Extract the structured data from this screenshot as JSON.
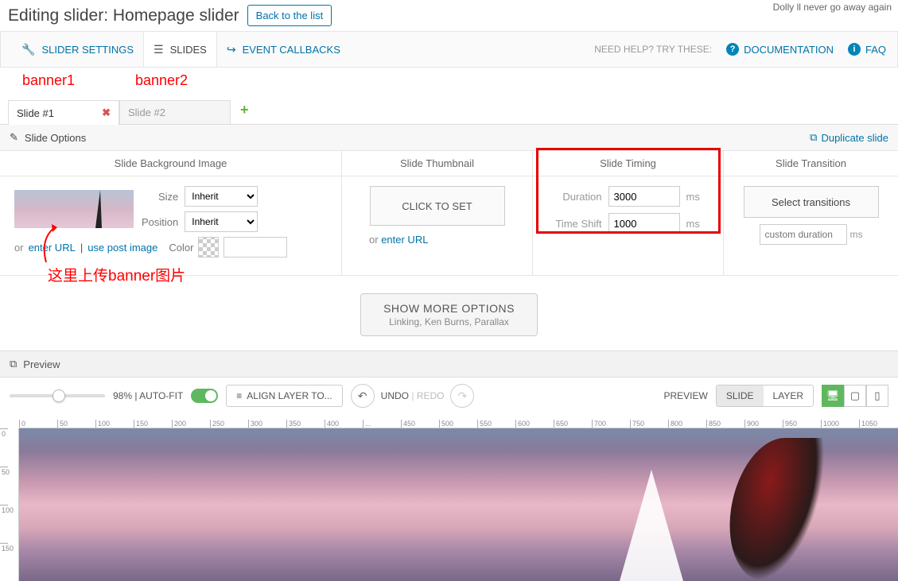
{
  "header": {
    "title": "Editing slider: Homepage slider",
    "back_btn": "Back to the list",
    "dolly": "Dolly ll never go away again"
  },
  "mainTabs": {
    "settings": "SLIDER SETTINGS",
    "slides": "SLIDES",
    "callbacks": "EVENT CALLBACKS"
  },
  "help": {
    "label": "NEED HELP? TRY THESE:",
    "documentation": "DOCUMENTATION",
    "faq": "FAQ"
  },
  "annotations": {
    "banner1": "banner1",
    "banner2": "banner2",
    "upload": "这里上传banner图片"
  },
  "slideTabs": {
    "tab1": "Slide #1",
    "tab2": "Slide #2"
  },
  "optionsBar": {
    "title": "Slide Options",
    "duplicate": "Duplicate slide"
  },
  "columns": {
    "bg": {
      "header": "Slide Background Image",
      "size_label": "Size",
      "size_value": "Inherit",
      "position_label": "Position",
      "position_value": "Inherit",
      "or": "or",
      "enter_url": "enter URL",
      "sep": " | ",
      "use_post": "use post image",
      "color_label": "Color"
    },
    "thumb": {
      "header": "Slide Thumbnail",
      "click_to_set": "CLICK TO SET",
      "or": "or",
      "enter_url": "enter URL"
    },
    "timing": {
      "header": "Slide Timing",
      "duration_label": "Duration",
      "duration_value": "3000",
      "timeshift_label": "Time Shift",
      "timeshift_value": "1000",
      "unit": "ms"
    },
    "trans": {
      "header": "Slide Transition",
      "select_btn": "Select transitions",
      "custom_placeholder": "custom duration",
      "unit": "ms"
    }
  },
  "showMore": {
    "line1": "SHOW MORE OPTIONS",
    "line2": "Linking, Ken Burns, Parallax"
  },
  "previewBar": {
    "label": "Preview"
  },
  "toolbar": {
    "zoom": "98%",
    "autofit_sep": " | ",
    "autofit": "AUTO-FIT",
    "align": "ALIGN LAYER TO...",
    "undo": "UNDO",
    "undo_sep": " | ",
    "redo": "REDO",
    "preview_label": "PREVIEW",
    "slide": "SLIDE",
    "layer": "LAYER"
  },
  "ruler_h": [
    "0",
    "50",
    "100",
    "150",
    "200",
    "250",
    "300",
    "350",
    "400",
    "...",
    "450",
    "500",
    "550",
    "600",
    "650",
    "700",
    "750",
    "800",
    "850",
    "900",
    "950",
    "1000",
    "1050"
  ],
  "ruler_v": [
    "0",
    "50",
    "100",
    "150"
  ]
}
